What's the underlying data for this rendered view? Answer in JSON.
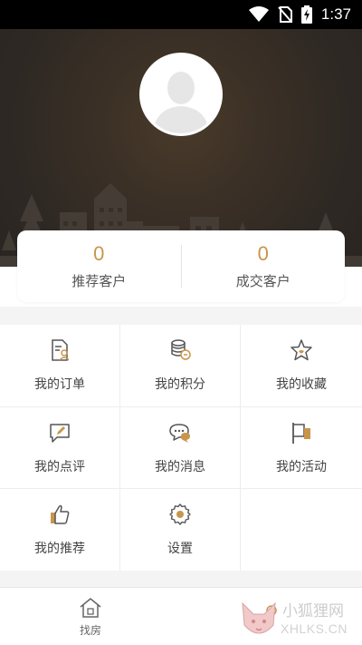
{
  "status_bar": {
    "time": "1:37",
    "icons": [
      "wifi-icon",
      "no-sim-icon",
      "battery-charging-icon"
    ]
  },
  "profile": {
    "avatar_icon": "default-user-avatar-icon"
  },
  "stats": [
    {
      "value": "0",
      "label": "推荐客户"
    },
    {
      "value": "0",
      "label": "成交客户"
    }
  ],
  "menu": [
    {
      "label": "我的订单",
      "icon": "order-document-icon"
    },
    {
      "label": "我的积分",
      "icon": "coins-stack-icon"
    },
    {
      "label": "我的收藏",
      "icon": "star-icon"
    },
    {
      "label": "我的点评",
      "icon": "edit-comment-icon"
    },
    {
      "label": "我的消息",
      "icon": "message-bubble-icon"
    },
    {
      "label": "我的活动",
      "icon": "flag-icon"
    },
    {
      "label": "我的推荐",
      "icon": "thumbs-up-icon"
    },
    {
      "label": "设置",
      "icon": "gear-icon"
    }
  ],
  "bottom_nav": [
    {
      "label": "找房",
      "icon": "house-icon"
    }
  ],
  "watermark": {
    "title": "小狐狸网",
    "subtitle": "XHLKS.CN"
  },
  "colors": {
    "accent": "#c8964a",
    "header_bg": "#2f2924",
    "page_bg": "#f4f4f4"
  }
}
